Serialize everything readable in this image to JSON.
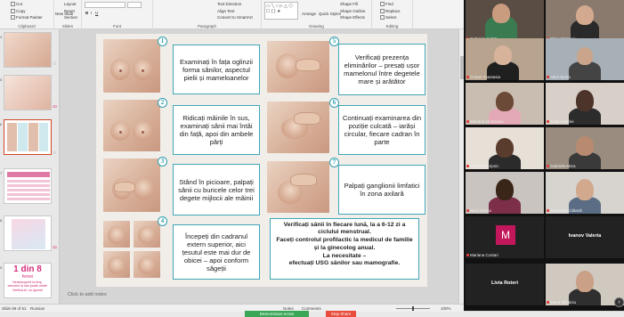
{
  "ribbon": {
    "groups": [
      {
        "label": "Clipboard",
        "items": [
          "Cut",
          "Copy",
          "Format Painter"
        ]
      },
      {
        "label": "Slides",
        "items": [
          "New Slide",
          "Layout",
          "Reset",
          "Section"
        ]
      },
      {
        "label": "Font",
        "items": []
      },
      {
        "label": "Paragraph",
        "items": [
          "Text Direction",
          "Align Text",
          "Convert to SmartArt"
        ]
      },
      {
        "label": "Drawing",
        "items": [
          "Arrange",
          "Quick Styles",
          "Shape Fill",
          "Shape Outline",
          "Shape Effects"
        ]
      },
      {
        "label": "Editing",
        "items": [
          "Find",
          "Replace",
          "Select"
        ]
      }
    ]
  },
  "thumbnails": {
    "numbers": [
      "4",
      "5",
      "6",
      "7",
      "8",
      "9"
    ],
    "banner_title": "1 din 8",
    "banner_sub": "femei",
    "banner_text": "Nedescoperit la timp, cancerul la sân poate ucide! Verifică-te, nu ignora!"
  },
  "slide": {
    "steps": [
      {
        "n": "1",
        "text": "Examinați în fața oglinzii forma sânilor, aspectul pielii și mameloanelor"
      },
      {
        "n": "2",
        "text": "Ridicați mâinile în sus, examinați sânii mai întâi din față, apoi din ambele părți"
      },
      {
        "n": "3",
        "text": "Stând în picioare, palpați sânii cu buricele celor trei degete mijlocii ale mâinii"
      },
      {
        "n": "4",
        "text": "Începeți din cadranul extern superior, aici țesutul este mai dur de obicei – apoi conform săgeții"
      },
      {
        "n": "5",
        "text": "Verificați prezența eliminărilor – presați ușor mamelonul între degetele mare și arătător"
      },
      {
        "n": "6",
        "text": "Continuați examinarea din poziție culcată – iarăși circular, fiecare cadran în parte"
      },
      {
        "n": "7",
        "text": "Palpați ganglionii limfatici în zona axilară"
      }
    ],
    "info_lines": [
      "Verificați sânii în fiecare lună, la a 6-12 zi a ciclului menstrual.",
      "Faceți controlul profilactic la medicul de familie și la ginecolog anual.",
      "La necesitate –",
      "efectuați USG sânilor sau mamografie."
    ],
    "notes_placeholder": "Click to add notes"
  },
  "status": {
    "slide_counter": "Slide 69 of 61",
    "language": "Russian",
    "notes": "Notes",
    "comments": "Comments",
    "zoom": "100%"
  },
  "taskbar": {
    "share_label": "Demonstrare ecran",
    "stop_label": "Stop Share"
  },
  "meeting": {
    "participants": [
      "Gabriela Jurleti",
      "Olga Vlemaniu",
      "Crioan Anastasia",
      "Alina Spina",
      "Mariana Munteanu",
      "Sofia Amariei",
      "Cristina Scripnic",
      "Gabriela Mora",
      "Nica Viorica",
      "Gheorghe Cătană",
      "Mariana Costari",
      "Ivanov Valeria",
      "Livia Roteri",
      "Maria Mihalciu"
    ],
    "avatar_letter": "M"
  }
}
